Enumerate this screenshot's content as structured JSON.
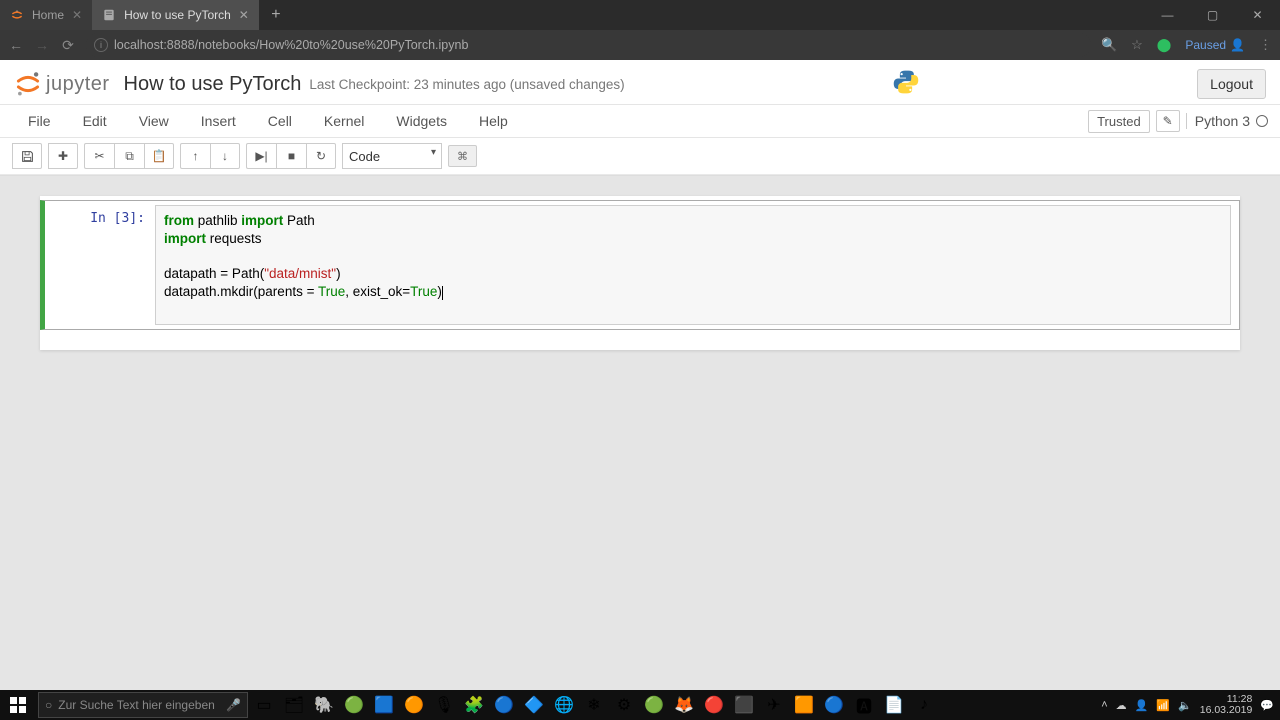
{
  "browser": {
    "tabs": [
      {
        "title": "Home",
        "active": false
      },
      {
        "title": "How to use PyTorch",
        "active": true
      }
    ],
    "url": "localhost:8888/notebooks/How%20to%20use%20PyTorch.ipynb",
    "profile_status": "Paused"
  },
  "header": {
    "logo_text": "jupyter",
    "nb_title": "How to use PyTorch",
    "checkpoint": "Last Checkpoint: 23 minutes ago (unsaved changes)",
    "logout": "Logout"
  },
  "menubar": {
    "items": [
      "File",
      "Edit",
      "View",
      "Insert",
      "Cell",
      "Kernel",
      "Widgets",
      "Help"
    ],
    "trusted": "Trusted",
    "kernel_name": "Python 3"
  },
  "toolbar": {
    "celltype": "Code"
  },
  "cell": {
    "prompt": "In [3]:",
    "code_lines": [
      {
        "tokens": [
          {
            "t": "from ",
            "c": "kw"
          },
          {
            "t": "pathlib ",
            "c": ""
          },
          {
            "t": "import ",
            "c": "kw"
          },
          {
            "t": "Path",
            "c": ""
          }
        ]
      },
      {
        "tokens": [
          {
            "t": "import ",
            "c": "kw"
          },
          {
            "t": "requests",
            "c": ""
          }
        ]
      },
      {
        "tokens": []
      },
      {
        "tokens": [
          {
            "t": "datapath = Path(",
            "c": ""
          },
          {
            "t": "\"data/mnist\"",
            "c": "str"
          },
          {
            "t": ")",
            "c": ""
          }
        ]
      },
      {
        "tokens": [
          {
            "t": "datapath.mkdir(parents = ",
            "c": ""
          },
          {
            "t": "True",
            "c": "builtin"
          },
          {
            "t": ", exist_ok=",
            "c": ""
          },
          {
            "t": "True",
            "c": "builtin"
          },
          {
            "t": ")",
            "c": ""
          }
        ]
      },
      {
        "tokens": []
      }
    ]
  },
  "windows": {
    "search_placeholder": "Zur Suche Text hier eingeben",
    "clock_time": "11:28",
    "clock_date": "16.03.2019"
  }
}
